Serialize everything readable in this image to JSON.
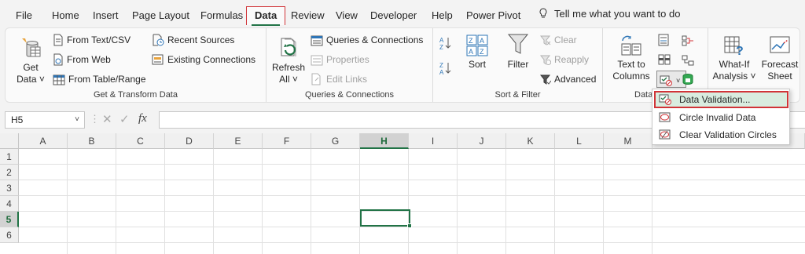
{
  "tabs": [
    "File",
    "Home",
    "Insert",
    "Page Layout",
    "Formulas",
    "Data",
    "Review",
    "View",
    "Developer",
    "Help",
    "Power Pivot"
  ],
  "active_tab": "Data",
  "tell_me": "Tell me what you want to do",
  "ribbon": {
    "get_transform": {
      "get_data_line1": "Get",
      "get_data_line2": "Data ˅",
      "from_text_csv": "From Text/CSV",
      "from_web": "From Web",
      "from_table_range": "From Table/Range",
      "recent_sources": "Recent Sources",
      "existing_connections": "Existing Connections",
      "label": "Get & Transform Data"
    },
    "queries": {
      "refresh_line1": "Refresh",
      "refresh_line2": "All ˅",
      "queries_connections": "Queries & Connections",
      "properties": "Properties",
      "edit_links": "Edit Links",
      "label": "Queries & Connections"
    },
    "sort_filter": {
      "sort": "Sort",
      "filter": "Filter",
      "clear": "Clear",
      "reapply": "Reapply",
      "advanced": "Advanced",
      "label": "Sort & Filter"
    },
    "data_tools": {
      "text_to_columns_line1": "Text to",
      "text_to_columns_line2": "Columns",
      "label": "Data"
    },
    "forecast": {
      "whatif_line1": "What-If",
      "whatif_line2": "Analysis ˅",
      "forecast_line1": "Forecast",
      "forecast_line2": "Sheet"
    }
  },
  "formula_bar": {
    "name_box": "H5",
    "fx": "fx",
    "value": ""
  },
  "sheet": {
    "columns": [
      "A",
      "B",
      "C",
      "D",
      "E",
      "F",
      "G",
      "H",
      "I",
      "J",
      "K",
      "L",
      "M"
    ],
    "rows": [
      "1",
      "2",
      "3",
      "4",
      "5",
      "6"
    ],
    "selected_col": "H",
    "selected_row": "5"
  },
  "validation_menu": {
    "items": [
      "Data Validation...",
      "Circle Invalid Data",
      "Clear Validation Circles"
    ]
  },
  "colors": {
    "excel_green": "#217346",
    "highlight_red": "#d13438"
  }
}
